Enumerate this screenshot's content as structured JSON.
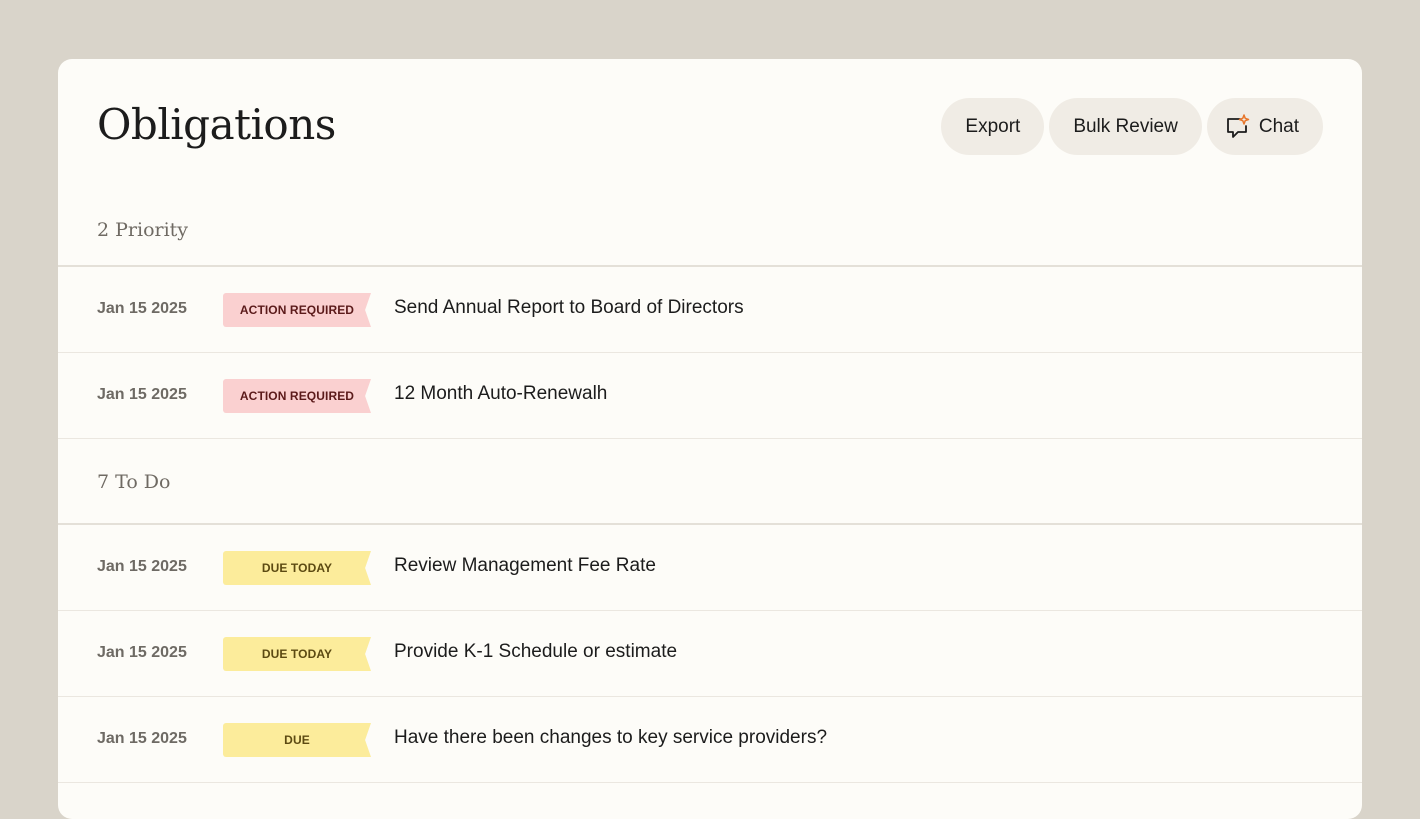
{
  "header": {
    "title": "Obligations",
    "buttons": {
      "export": "Export",
      "bulk_review": "Bulk Review",
      "chat": "Chat"
    }
  },
  "sections": [
    {
      "label": "2 Priority",
      "rows": [
        {
          "date": "Jan 15 2025",
          "badge": "ACTION REQUIRED",
          "task": "Send Annual Report to Board of Directors"
        },
        {
          "date": "Jan 15 2025",
          "badge": "ACTION REQUIRED",
          "task": "12 Month Auto-Renewalh"
        }
      ]
    },
    {
      "label": "7 To Do",
      "rows": [
        {
          "date": "Jan 15 2025",
          "badge": "DUE TODAY",
          "task": "Review Management Fee Rate"
        },
        {
          "date": "Jan 15 2025",
          "badge": "DUE TODAY",
          "task": "Provide K-1 Schedule or estimate"
        },
        {
          "date": "Jan 15 2025",
          "badge": "DUE",
          "task": "Have there been changes to key service providers?"
        }
      ]
    }
  ],
  "colors": {
    "background": "#d9d4ca",
    "panel": "#fdfcf8",
    "badge_action_required": "#fad0d0",
    "badge_due": "#fcec9b",
    "chat_sparkle": "#e8762b"
  },
  "icons": {
    "chat": "chat-sparkle-icon"
  }
}
